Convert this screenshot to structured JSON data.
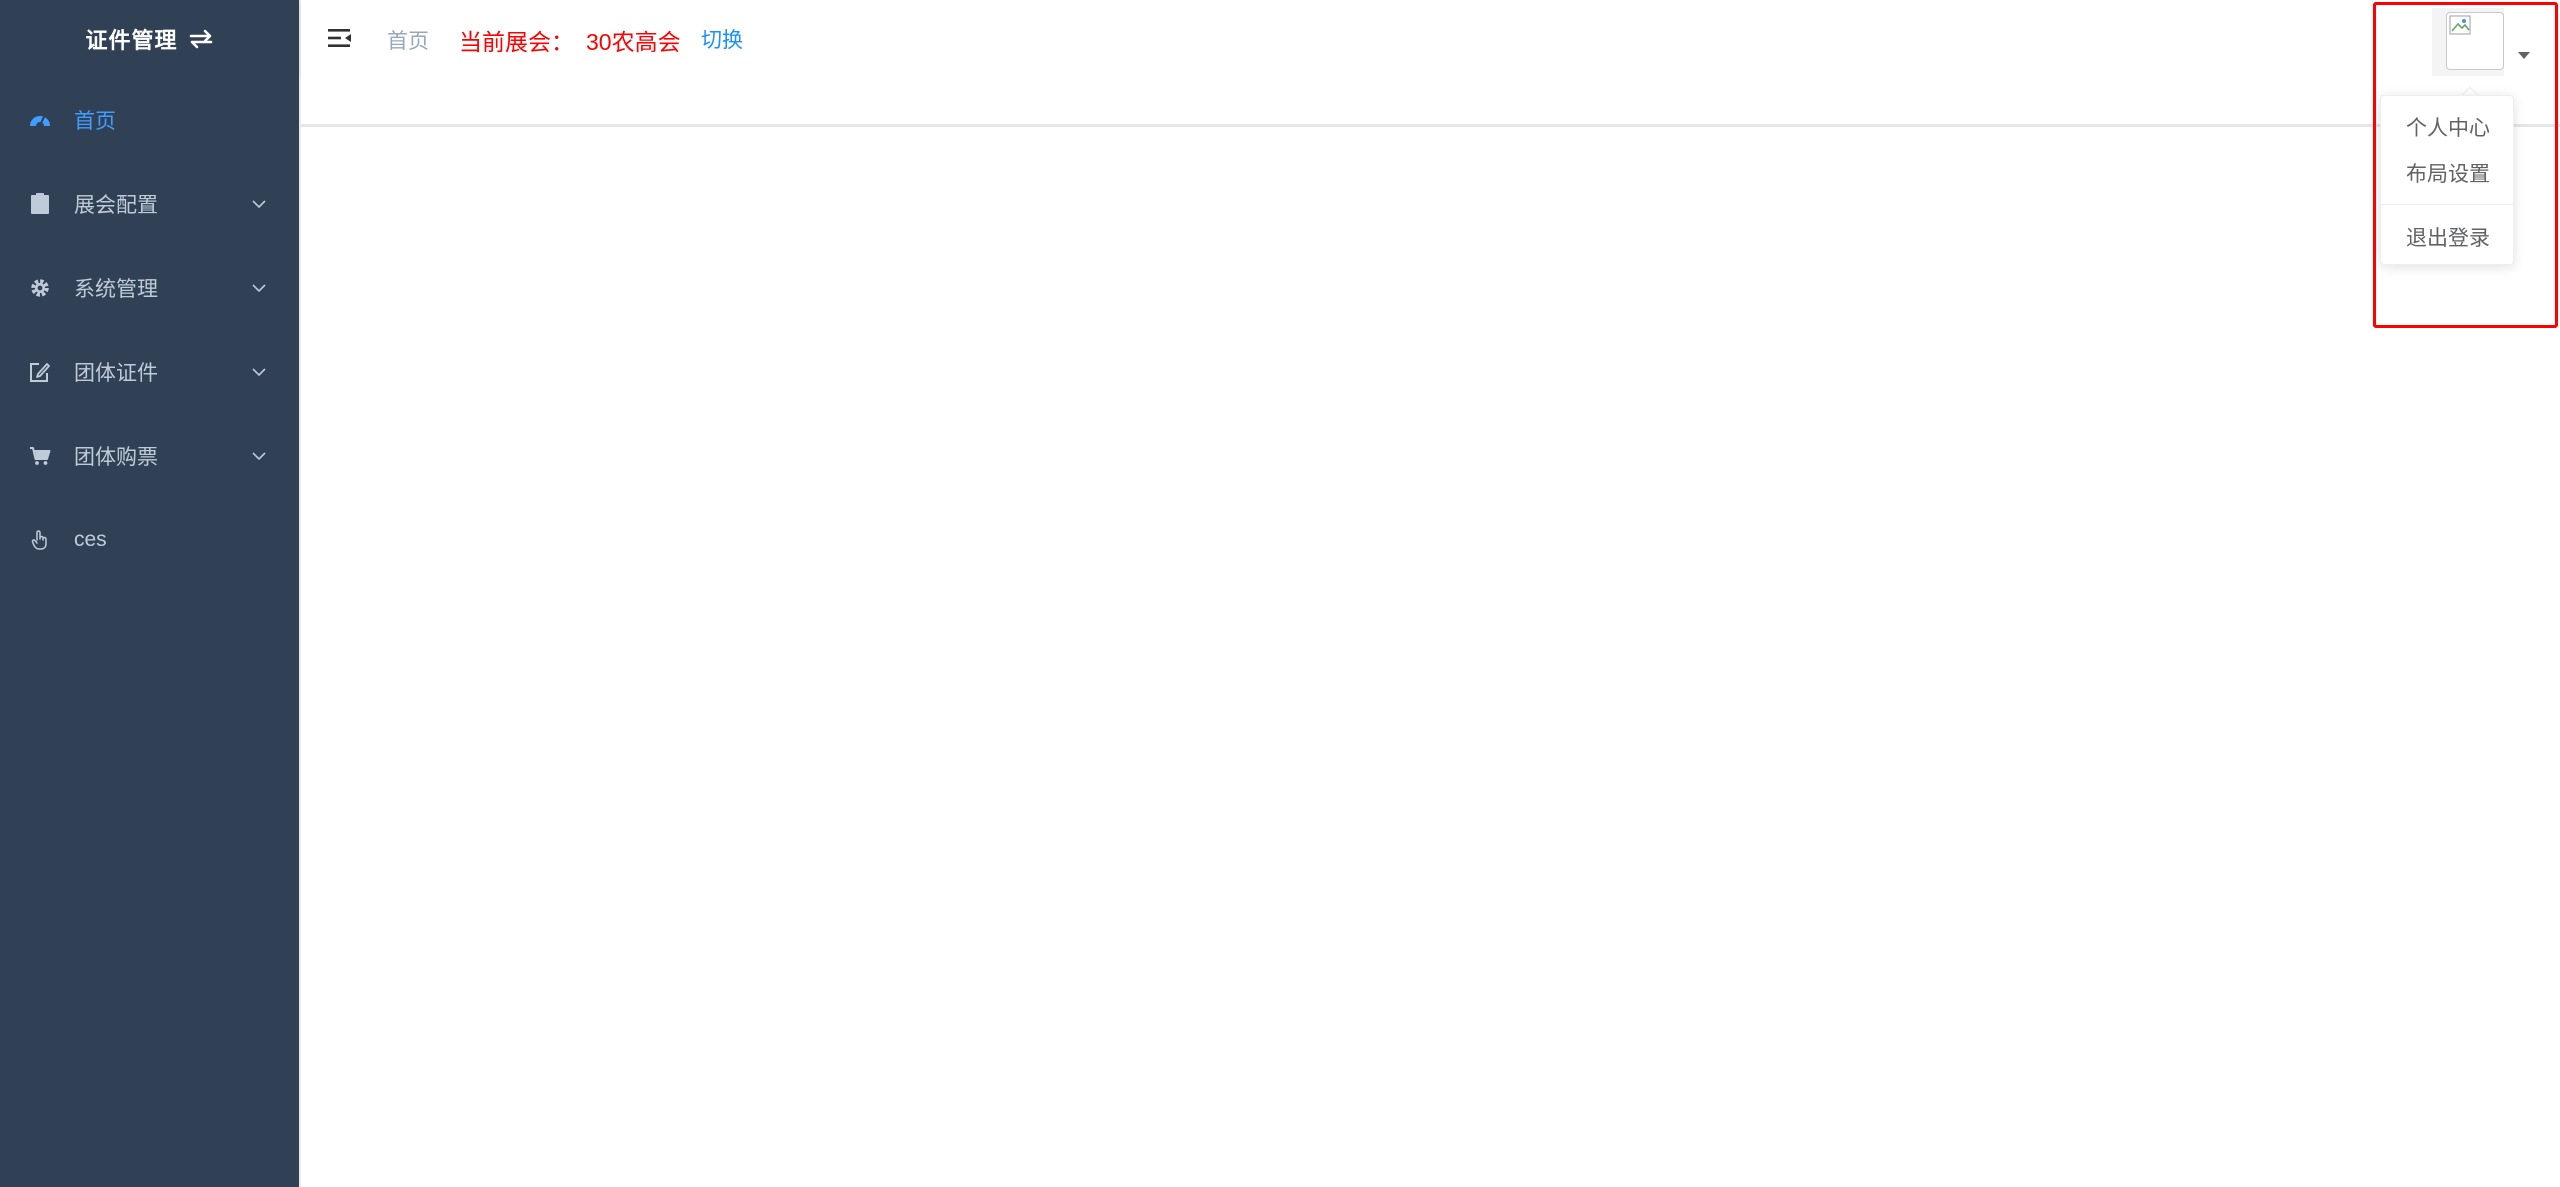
{
  "sidebar": {
    "title": "证件管理",
    "items": [
      {
        "label": "首页",
        "icon": "dashboard-icon"
      },
      {
        "label": "展会配置",
        "icon": "clipboard-icon"
      },
      {
        "label": "系统管理",
        "icon": "gear-icon"
      },
      {
        "label": "团体证件",
        "icon": "edit-icon"
      },
      {
        "label": "团体购票",
        "icon": "cart-icon"
      },
      {
        "label": "ces",
        "icon": "hand-pointer-icon"
      }
    ]
  },
  "navbar": {
    "breadcrumb": "首页",
    "current_expo_label": "当前展会：",
    "current_expo_name": "30农高会",
    "switch_label": "切换"
  },
  "user_menu": {
    "items": [
      "个人中心",
      "布局设置",
      "退出登录"
    ]
  },
  "colors": {
    "sidebar_bg": "#304156",
    "sidebar_text": "#bfcbd9",
    "active": "#409eff",
    "expo_text": "#ff0000",
    "link": "#1890ff"
  }
}
